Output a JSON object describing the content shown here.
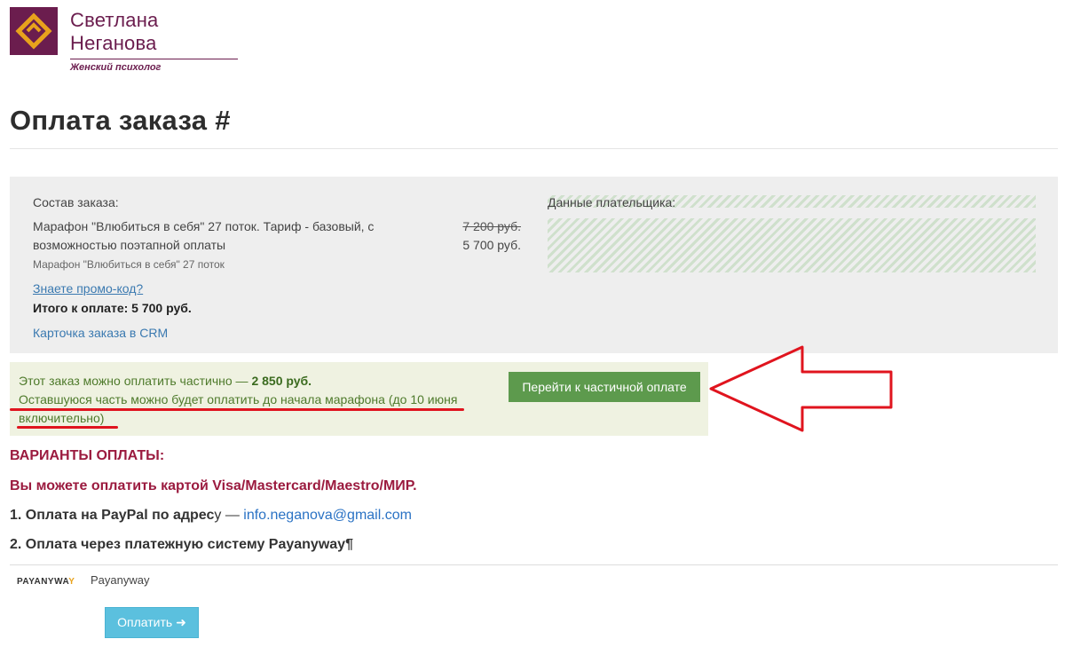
{
  "header": {
    "brand_name": "Светлана Неганова",
    "brand_subtitle": "Женский психолог"
  },
  "page": {
    "title": "Оплата заказа #"
  },
  "order": {
    "composition_label": "Состав заказа:",
    "item_name": "Марафон \"Влюбиться в себя\" 27 поток. Тариф - базовый, с возможностью поэтапной оплаты",
    "item_subtitle": "Марафон \"Влюбиться в себя\" 27 поток",
    "old_price": "7 200 руб.",
    "new_price": "5 700 руб.",
    "promo_link": "Знаете промо-код?",
    "total": "Итого к оплате: 5 700 руб.",
    "crm_link": "Карточка заказа в CRM",
    "payer_label": "Данные плательщика:"
  },
  "partial": {
    "text": "Этот заказ можно оплатить частично — ",
    "amount": "2 850 руб.",
    "note": "Оставшуюся часть можно будет оплатить до начала марафона (до 10 июня включительно)",
    "button_label": "Перейти к частичной оплате"
  },
  "payment": {
    "variants_title": "ВАРИАНТЫ ОПЛАТЫ:",
    "cards_text": "Вы можете оплатить картой Visa/Mastercard/Maestro/МИР.",
    "paypal_prefix": "1. Оплата на PayPal по адрес",
    "paypal_suffix": "у — ",
    "paypal_email": "info.neganova@gmail.com",
    "payanyway_text": "2. Оплата через платежную систему Payanyway¶",
    "method_logo_a": "PAYANYWA",
    "method_logo_b": "Y",
    "method_name": "Payanyway",
    "pay_button": "Оплатить"
  },
  "colors": {
    "brand": "#6b1d4e",
    "accent_red": "#9b1b3f",
    "partial_button": "#5d9a4d",
    "pay_button": "#5bc0de",
    "annotation": "#e0141e"
  }
}
